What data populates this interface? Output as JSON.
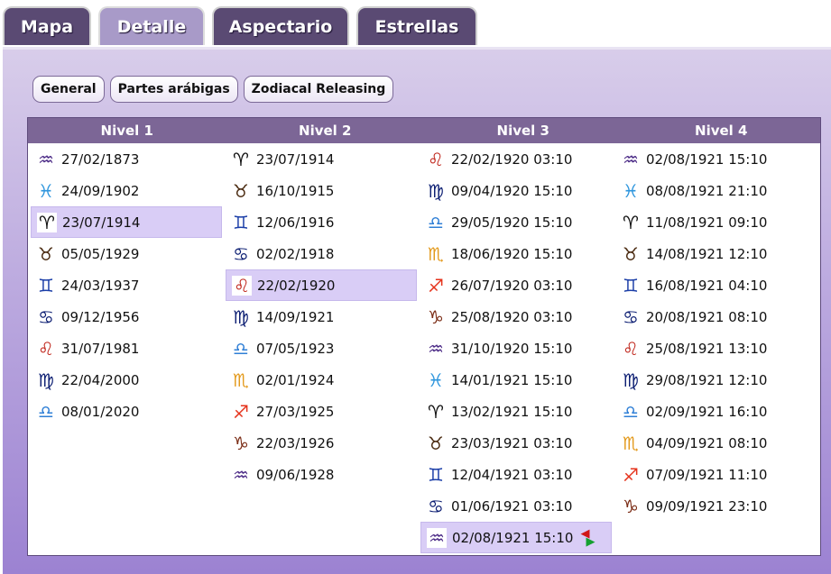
{
  "tabs": [
    {
      "label": "Mapa"
    },
    {
      "label": "Detalle"
    },
    {
      "label": "Aspectario"
    },
    {
      "label": "Estrellas"
    }
  ],
  "subtabs": [
    {
      "label": "General"
    },
    {
      "label": "Partes arábigas"
    },
    {
      "label": "Zodiacal Releasing"
    }
  ],
  "headers": [
    "Nivel 1",
    "Nivel 2",
    "Nivel 3",
    "Nivel 4"
  ],
  "sign_glyphs": {
    "aries": "♈",
    "taurus": "♉",
    "gemini": "♊",
    "cancer": "♋",
    "leo": "♌",
    "virgo": "♍",
    "libra": "♎",
    "scorpio": "♏",
    "sagittarius": "♐",
    "capricorn": "♑",
    "aquarius": "♒",
    "pisces": "♓"
  },
  "sign_colors": {
    "aries": "#111111",
    "taurus": "#4a2a10",
    "gemini": "#1c3fa8",
    "cancer": "#0d1f73",
    "leo": "#c0261c",
    "virgo": "#0d1f73",
    "libra": "#2f7fd6",
    "scorpio": "#e39a1d",
    "sagittarius": "#e5331c",
    "capricorn": "#7a2b14",
    "aquarius": "#4b2a86",
    "pisces": "#2d95dd"
  },
  "columns": [
    {
      "rows": [
        {
          "sign": "aquarius",
          "date": "27/02/1873"
        },
        {
          "sign": "pisces",
          "date": "24/09/1902"
        },
        {
          "sign": "aries",
          "date": "23/07/1914",
          "selected": true
        },
        {
          "sign": "taurus",
          "date": "05/05/1929"
        },
        {
          "sign": "gemini",
          "date": "24/03/1937"
        },
        {
          "sign": "cancer",
          "date": "09/12/1956"
        },
        {
          "sign": "leo",
          "date": "31/07/1981"
        },
        {
          "sign": "virgo",
          "date": "22/04/2000"
        },
        {
          "sign": "libra",
          "date": "08/01/2020"
        }
      ]
    },
    {
      "rows": [
        {
          "sign": "aries",
          "date": "23/07/1914"
        },
        {
          "sign": "taurus",
          "date": "16/10/1915"
        },
        {
          "sign": "gemini",
          "date": "12/06/1916"
        },
        {
          "sign": "cancer",
          "date": "02/02/1918"
        },
        {
          "sign": "leo",
          "date": "22/02/1920",
          "selected": true
        },
        {
          "sign": "virgo",
          "date": "14/09/1921"
        },
        {
          "sign": "libra",
          "date": "07/05/1923"
        },
        {
          "sign": "scorpio",
          "date": "02/01/1924"
        },
        {
          "sign": "sagittarius",
          "date": "27/03/1925"
        },
        {
          "sign": "capricorn",
          "date": "22/03/1926"
        },
        {
          "sign": "aquarius",
          "date": "09/06/1928"
        }
      ]
    },
    {
      "rows": [
        {
          "sign": "leo",
          "date": "22/02/1920 03:10"
        },
        {
          "sign": "virgo",
          "date": "09/04/1920 15:10"
        },
        {
          "sign": "libra",
          "date": "29/05/1920 15:10"
        },
        {
          "sign": "scorpio",
          "date": "18/06/1920 15:10"
        },
        {
          "sign": "sagittarius",
          "date": "26/07/1920 03:10"
        },
        {
          "sign": "capricorn",
          "date": "25/08/1920 03:10"
        },
        {
          "sign": "aquarius",
          "date": "31/10/1920 15:10"
        },
        {
          "sign": "pisces",
          "date": "14/01/1921 15:10"
        },
        {
          "sign": "aries",
          "date": "13/02/1921 15:10"
        },
        {
          "sign": "taurus",
          "date": "23/03/1921 03:10"
        },
        {
          "sign": "gemini",
          "date": "12/04/1921 03:10"
        },
        {
          "sign": "cancer",
          "date": "01/06/1921 03:10"
        },
        {
          "sign": "aquarius",
          "date": "02/08/1921 15:10",
          "selected": true,
          "swap": true
        }
      ]
    },
    {
      "rows": [
        {
          "sign": "aquarius",
          "date": "02/08/1921 15:10"
        },
        {
          "sign": "pisces",
          "date": "08/08/1921 21:10"
        },
        {
          "sign": "aries",
          "date": "11/08/1921 09:10"
        },
        {
          "sign": "taurus",
          "date": "14/08/1921 12:10"
        },
        {
          "sign": "gemini",
          "date": "16/08/1921 04:10"
        },
        {
          "sign": "cancer",
          "date": "20/08/1921 08:10"
        },
        {
          "sign": "leo",
          "date": "25/08/1921 13:10"
        },
        {
          "sign": "virgo",
          "date": "29/08/1921 12:10"
        },
        {
          "sign": "libra",
          "date": "02/09/1921 16:10"
        },
        {
          "sign": "scorpio",
          "date": "04/09/1921 08:10"
        },
        {
          "sign": "sagittarius",
          "date": "07/09/1921 11:10"
        },
        {
          "sign": "capricorn",
          "date": "09/09/1921 23:10"
        }
      ]
    }
  ]
}
